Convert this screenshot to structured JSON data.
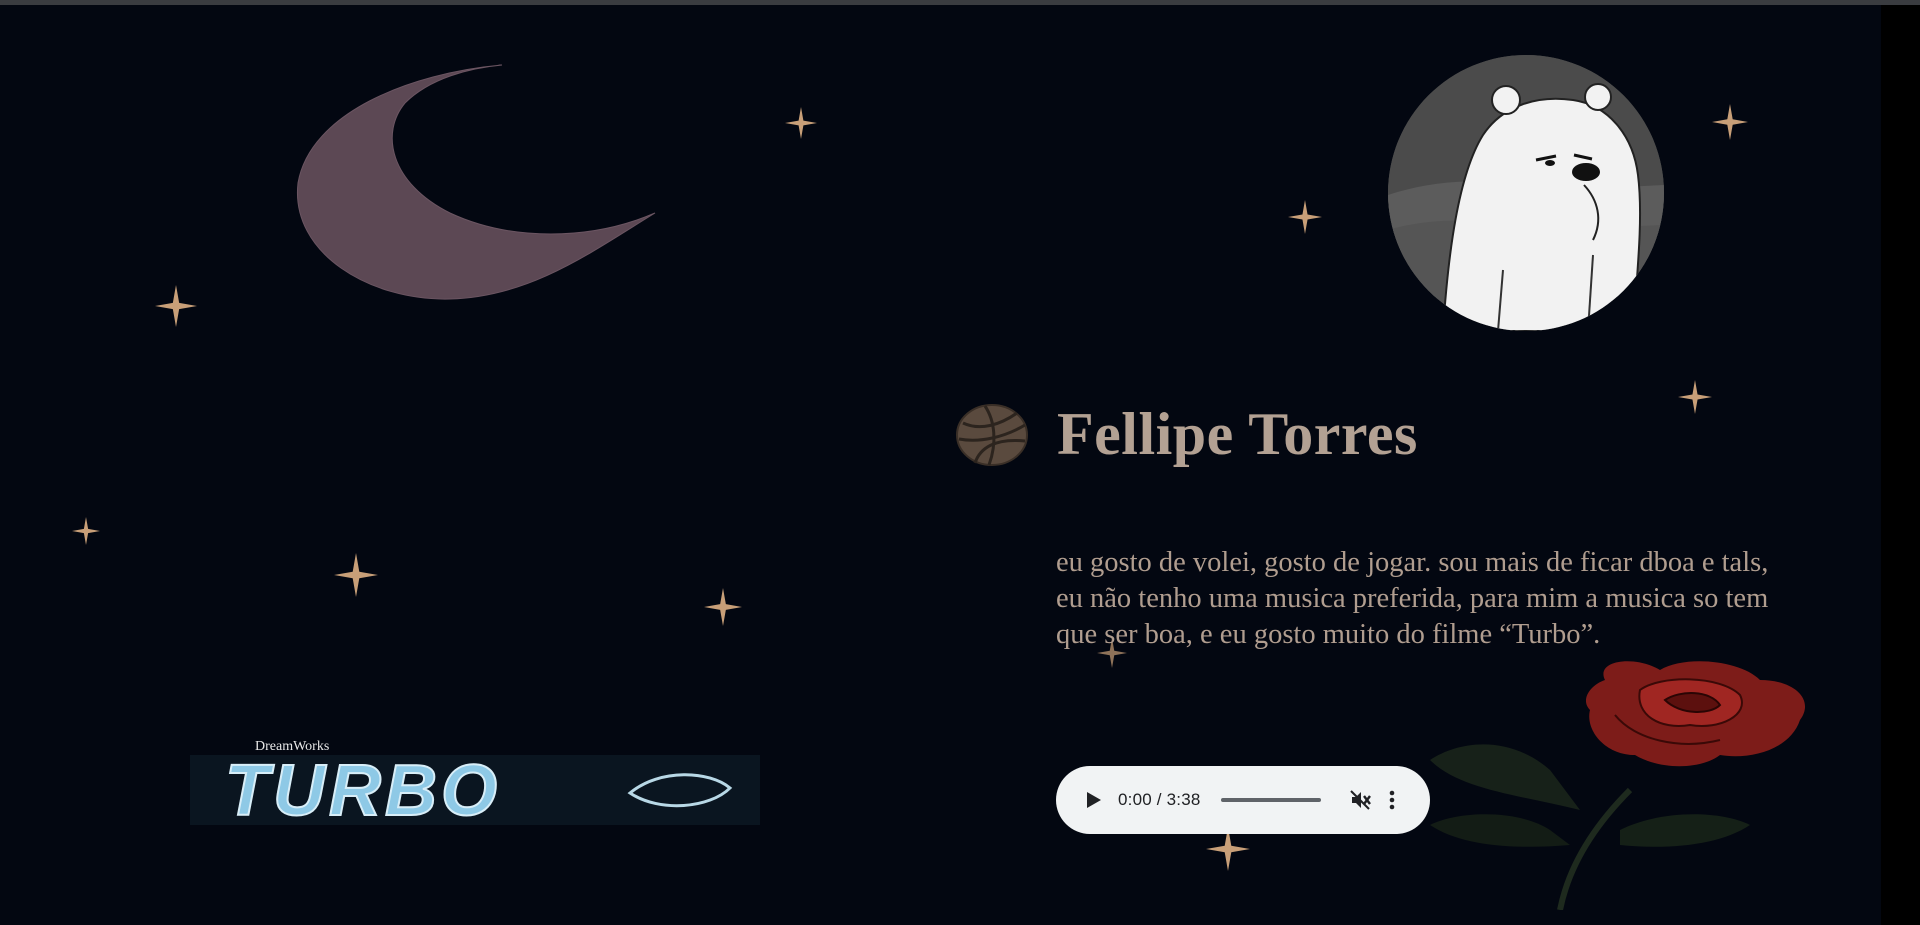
{
  "profile": {
    "name": "Fellipe Torres",
    "bio": "eu gosto de volei, gosto de jogar. sou mais de ficar dboa e tals, eu não tenho uma musica preferida, para mim a musica so tem que ser boa, e eu gosto muito do filme “Turbo”."
  },
  "logo": {
    "brand": "DreamWorks",
    "title": "TURBO"
  },
  "audio_player": {
    "time": "0:00 / 3:38",
    "progress": 0,
    "muted": true,
    "icons": [
      "play-icon",
      "volume-muted-icon",
      "more-vert-icon"
    ]
  },
  "colors": {
    "background": "#030711",
    "title": "#b3a193",
    "text": "#b09d8f",
    "star": "#c89f78",
    "moon": "#5f4a55",
    "rose": "#8a1d1a"
  }
}
